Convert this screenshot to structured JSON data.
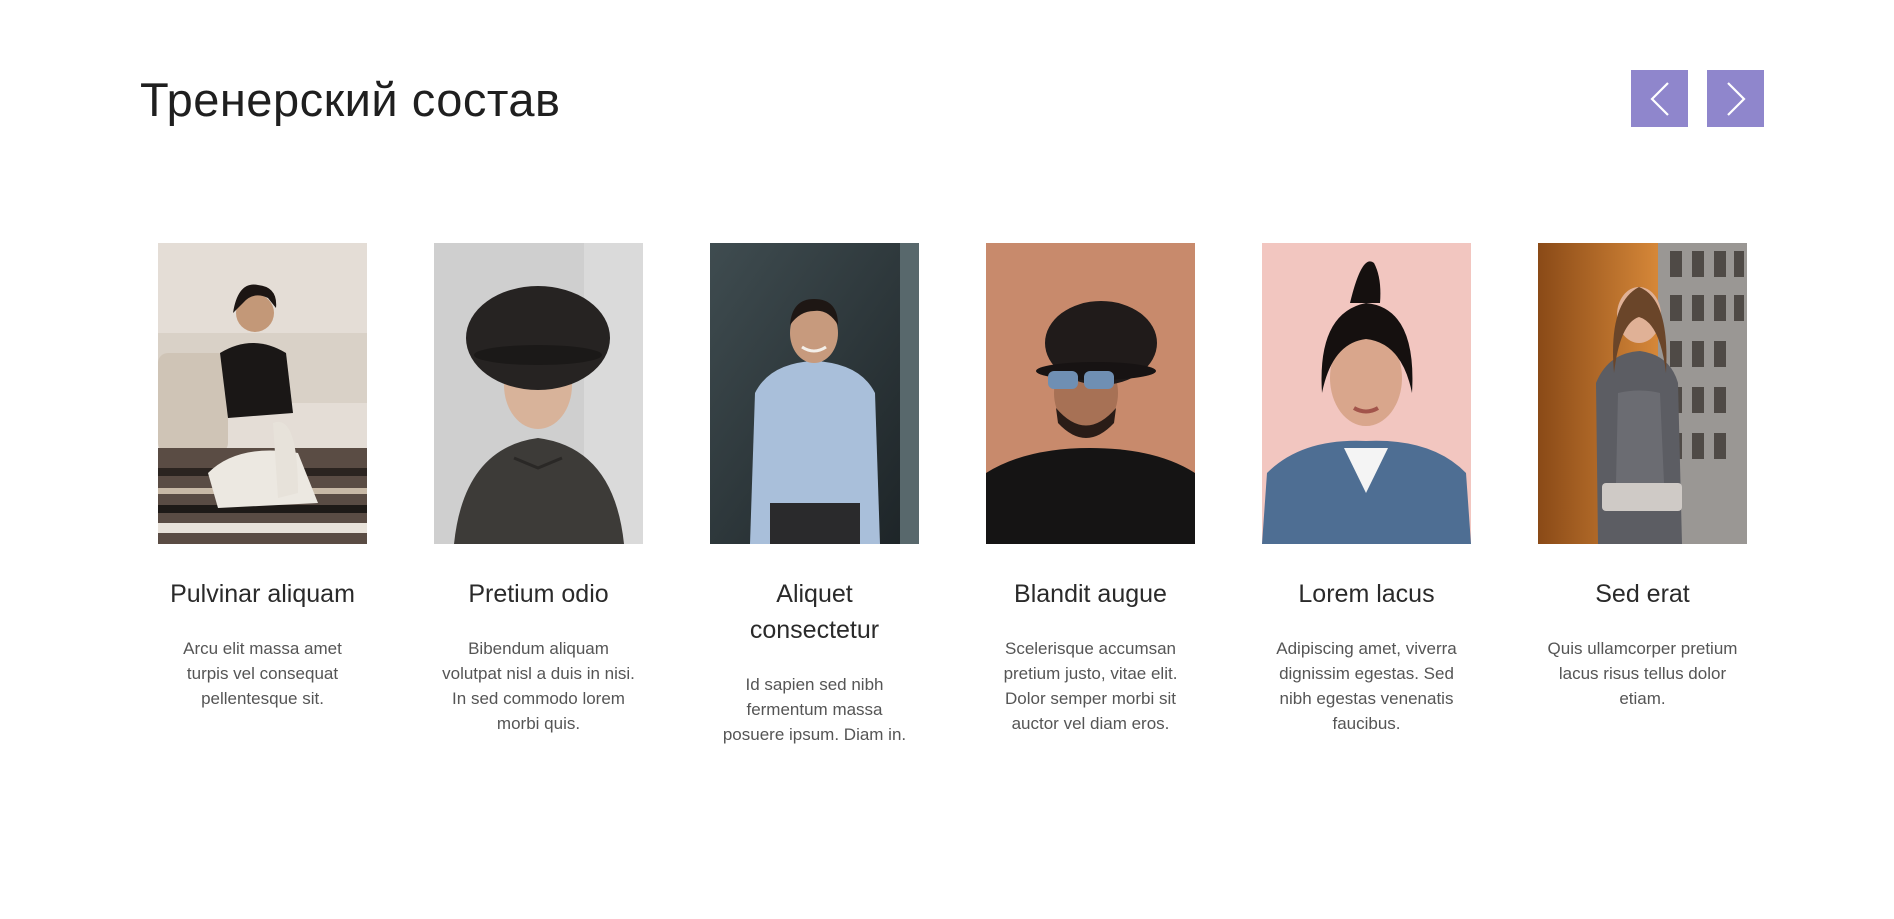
{
  "section": {
    "title": "Тренерский состав"
  },
  "navigation": {
    "prev_icon": "chevron-left-icon",
    "next_icon": "chevron-right-icon",
    "accent_color": "#8f86cc"
  },
  "trainers": [
    {
      "name": "Pulvinar aliquam",
      "description": "Arcu elit massa amet turpis vel consequat pellentesque sit."
    },
    {
      "name": "Pretium odio",
      "description": "Bibendum aliquam volutpat nisl a duis in nisi. In sed commodo lorem morbi quis."
    },
    {
      "name": "Aliquet consectetur",
      "description": "Id sapien sed nibh fermentum massa posuere ipsum. Diam in."
    },
    {
      "name": "Blandit augue",
      "description": "Scelerisque accumsan pretium justo, vitae elit. Dolor semper morbi sit auctor vel diam eros."
    },
    {
      "name": "Lorem lacus",
      "description": "Adipiscing amet, viverra dignissim egestas. Sed nibh egestas venenatis faucibus."
    },
    {
      "name": "Sed erat",
      "description": "Quis ullamcorper pretium lacus risus tellus dolor etiam."
    }
  ]
}
